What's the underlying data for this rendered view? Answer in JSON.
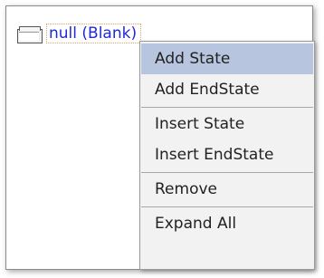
{
  "tree": {
    "node_label": "null (Blank)",
    "node_icon": "folder-icon"
  },
  "context_menu": {
    "items": [
      {
        "label": "Add State",
        "highlighted": true
      },
      {
        "label": "Add EndState",
        "highlighted": false
      },
      {
        "label": "Insert State",
        "highlighted": false
      },
      {
        "label": "Insert EndState",
        "highlighted": false
      },
      {
        "label": "Remove",
        "highlighted": false
      },
      {
        "label": "Expand All",
        "highlighted": false
      }
    ]
  },
  "colors": {
    "highlight": "#b7c5de",
    "node_text": "#1f2ad6",
    "menu_bg": "#f2f2f2"
  }
}
